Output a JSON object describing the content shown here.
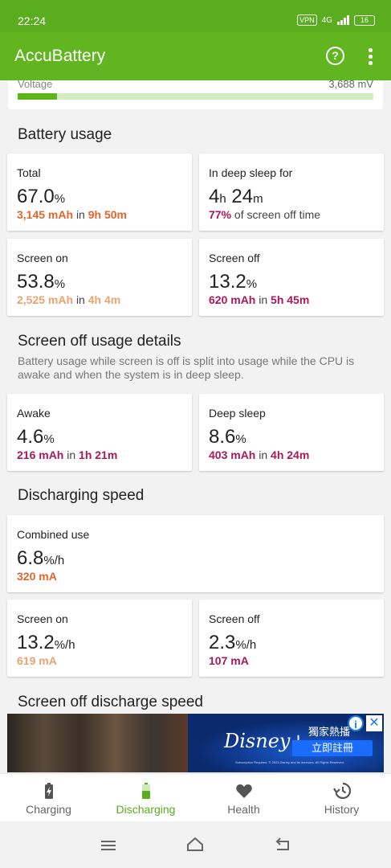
{
  "status_bar": {
    "time": "22:24",
    "vpn": "VPN",
    "network": "4G",
    "battery": "16"
  },
  "app_bar": {
    "title": "AccuBattery",
    "help_icon": "help-circle-icon",
    "menu_icon": "more-vertical-icon"
  },
  "voltage": {
    "label": "Voltage",
    "value": "3,688 mV",
    "level_fraction": 0.11
  },
  "battery_usage": {
    "title": "Battery usage",
    "total": {
      "label": "Total",
      "value": "67.0",
      "unit": "%",
      "mah": "3,145 mAh",
      "in": "in",
      "duration": "9h 50m"
    },
    "deep_sleep": {
      "label": "In deep sleep for",
      "hours": "4",
      "h_unit": "h",
      "minutes": "24",
      "m_unit": "m",
      "pct": "77%",
      "rest": "of screen off time"
    },
    "screen_on": {
      "label": "Screen on",
      "value": "53.8",
      "unit": "%",
      "mah": "2,525 mAh",
      "in": "in",
      "duration": "4h 4m"
    },
    "screen_off": {
      "label": "Screen off",
      "value": "13.2",
      "unit": "%",
      "mah": "620 mAh",
      "in": "in",
      "duration": "5h 45m"
    }
  },
  "screen_off_details": {
    "title": "Screen off usage details",
    "description": "Battery usage while screen is off is split into usage while the CPU is awake and when the system is in deep sleep.",
    "awake": {
      "label": "Awake",
      "value": "4.6",
      "unit": "%",
      "mah": "216 mAh",
      "in": "in",
      "duration": "1h 21m"
    },
    "deep_sleep": {
      "label": "Deep sleep",
      "value": "8.6",
      "unit": "%",
      "mah": "403 mAh",
      "in": "in",
      "duration": "4h 24m"
    }
  },
  "discharging_speed": {
    "title": "Discharging speed",
    "combined": {
      "label": "Combined use",
      "value": "6.8",
      "unit": "%/h",
      "current": "320 mA"
    },
    "screen_on": {
      "label": "Screen on",
      "value": "13.2",
      "unit": "%/h",
      "current": "619 mA"
    },
    "screen_off": {
      "label": "Screen off",
      "value": "2.3",
      "unit": "%/h",
      "current": "107 mA"
    }
  },
  "screen_off_discharge": {
    "title": "Screen off discharge speed"
  },
  "ad": {
    "brand": "Disney+",
    "promo": "獨家熱播",
    "cta": "立即註冊",
    "fine_print": "Subscription Required. © 2023 Disney and its licensors. All Rights Reserved."
  },
  "bottom_nav": [
    {
      "label": "Charging",
      "icon": "battery-charging-icon",
      "active": false
    },
    {
      "label": "Discharging",
      "icon": "battery-icon",
      "active": true
    },
    {
      "label": "Health",
      "icon": "heart-icon",
      "active": false
    },
    {
      "label": "History",
      "icon": "history-icon",
      "active": false
    }
  ],
  "colors": {
    "accent": "#61b520",
    "orange": "#e4662a",
    "light_orange": "#e9a36e",
    "purple": "#a8185a"
  }
}
